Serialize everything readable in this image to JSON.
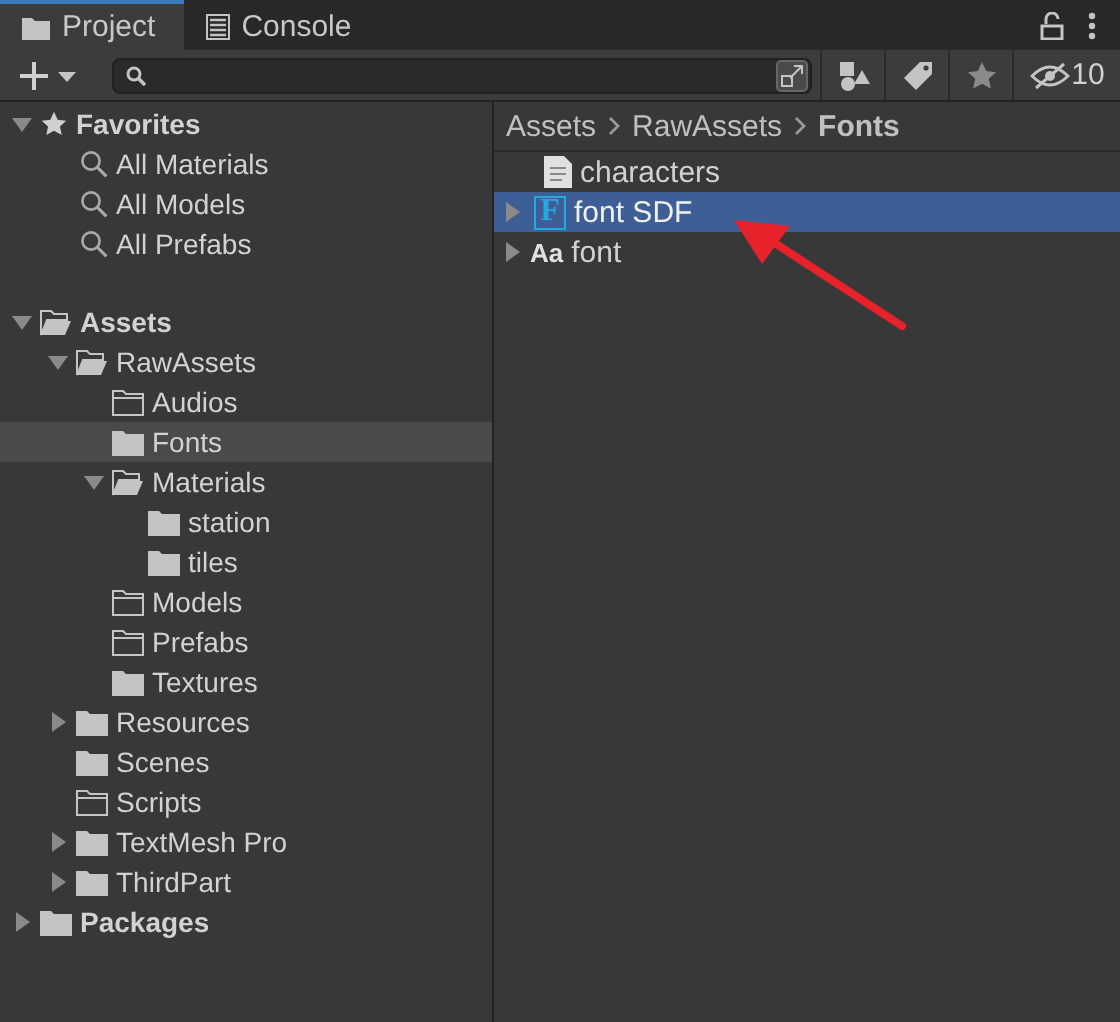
{
  "tabs": [
    {
      "label": "Project",
      "kind": "folder",
      "selected": true
    },
    {
      "label": "Console",
      "kind": "console",
      "selected": false
    }
  ],
  "toolbar": {
    "hidden_count": "10"
  },
  "favorites": {
    "label": "Favorites",
    "expanded": true,
    "items": [
      "All Materials",
      "All Models",
      "All Prefabs"
    ]
  },
  "tree": [
    {
      "label": "Assets",
      "kind": "open",
      "expanded": true,
      "selected": false,
      "children": [
        {
          "label": "RawAssets",
          "kind": "open",
          "expanded": true,
          "selected": false,
          "children": [
            {
              "label": "Audios",
              "kind": "empty",
              "selected": false
            },
            {
              "label": "Fonts",
              "kind": "filled",
              "selected": true
            },
            {
              "label": "Materials",
              "kind": "open",
              "expanded": true,
              "selected": false,
              "children": [
                {
                  "label": "station",
                  "kind": "filled",
                  "selected": false
                },
                {
                  "label": "tiles",
                  "kind": "filled",
                  "selected": false
                }
              ]
            },
            {
              "label": "Models",
              "kind": "empty",
              "selected": false
            },
            {
              "label": "Prefabs",
              "kind": "empty",
              "selected": false
            },
            {
              "label": "Textures",
              "kind": "filled",
              "selected": false
            }
          ]
        },
        {
          "label": "Resources",
          "kind": "filled",
          "expanded": false,
          "selected": false
        },
        {
          "label": "Scenes",
          "kind": "filled",
          "selected": false
        },
        {
          "label": "Scripts",
          "kind": "empty",
          "selected": false
        },
        {
          "label": "TextMesh Pro",
          "kind": "filled",
          "expanded": false,
          "selected": false
        },
        {
          "label": "ThirdPart",
          "kind": "filled",
          "expanded": false,
          "selected": false
        }
      ]
    },
    {
      "label": "Packages",
      "kind": "filled",
      "expanded": false,
      "selected": false
    }
  ],
  "breadcrumb": [
    "Assets",
    "RawAssets",
    "Fonts"
  ],
  "files": [
    {
      "label": "characters",
      "kind": "text",
      "expandable": false,
      "selected": false
    },
    {
      "label": "font SDF",
      "kind": "font-asset",
      "icon_text": "F",
      "expandable": true,
      "selected": true
    },
    {
      "label": "font",
      "kind": "font",
      "icon_text": "Aa",
      "expandable": true,
      "selected": false
    }
  ]
}
